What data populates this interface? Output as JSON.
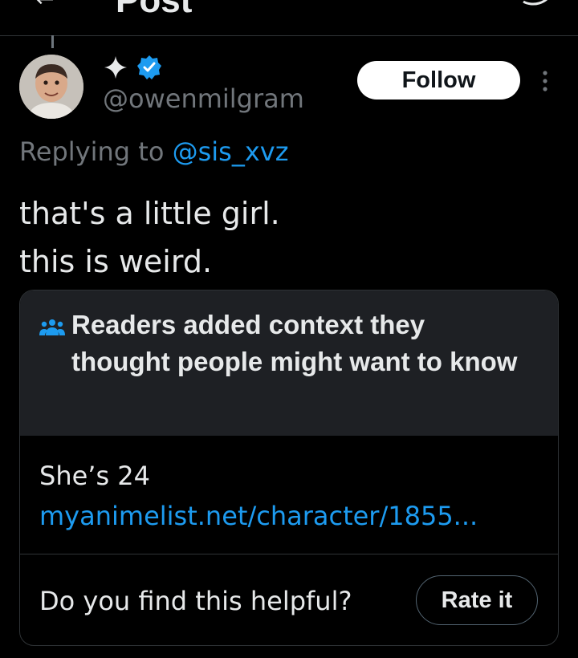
{
  "header": {
    "title": "Post",
    "back_icon": "back-arrow-icon",
    "right_icon": "grok-icon"
  },
  "post": {
    "author": {
      "handle": "@owenmilgram",
      "verified": true,
      "badge_icon": "sparkle-icon",
      "verified_icon": "verified-badge-icon",
      "verified_color": "#1d9bf0"
    },
    "follow_label": "Follow",
    "more_icon": "more-vertical-icon",
    "replying_prefix": "Replying to",
    "replying_to": "@sis_xvz",
    "text_lines": [
      "that's a little girl.",
      "this is weird."
    ]
  },
  "community_note": {
    "icon": "people-icon",
    "title": "Readers added context they thought people might want to know",
    "body": "She’s 24",
    "link": "myanimelist.net/character/1855...",
    "helpful_question": "Do you find this helpful?",
    "rate_label": "Rate it"
  },
  "colors": {
    "background": "#000000",
    "text": "#e7e9ea",
    "secondary_text": "#71767b",
    "accent": "#1d9bf0",
    "note_header_bg": "#1e2024",
    "border": "#2f3336"
  }
}
